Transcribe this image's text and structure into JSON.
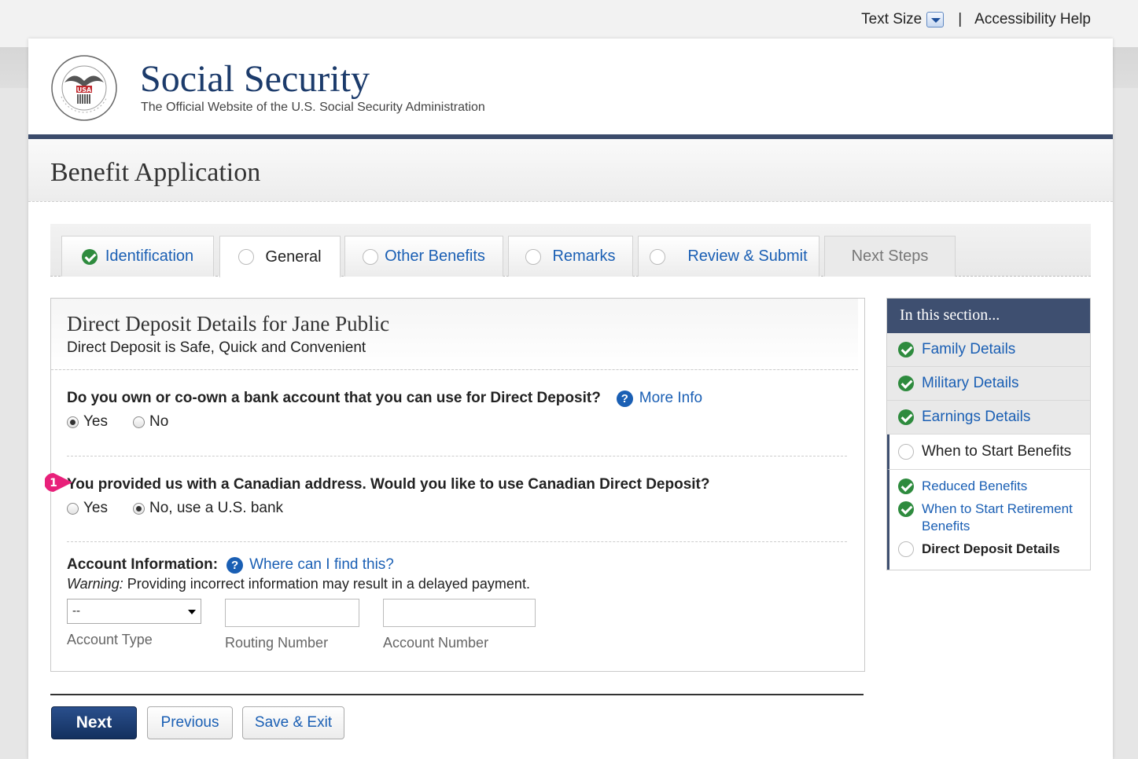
{
  "topbar": {
    "text_size": "Text Size",
    "separator": "|",
    "accessibility": "Accessibility Help"
  },
  "header": {
    "title": "Social Security",
    "subtitle": "The Official Website of the U.S. Social Security Administration",
    "seal_text": "SOCIAL SECURITY ADMINISTRATION USA"
  },
  "app": {
    "title": "Benefit Application"
  },
  "tabs": [
    {
      "label": "Identification",
      "status": "complete"
    },
    {
      "label": "General",
      "status": "current"
    },
    {
      "label": "Other Benefits",
      "status": "pending"
    },
    {
      "label": "Remarks",
      "status": "pending"
    },
    {
      "label": "Review & Submit",
      "status": "pending"
    },
    {
      "label": "Next Steps",
      "status": "disabled"
    }
  ],
  "form": {
    "title": "Direct Deposit Details for Jane Public",
    "subtitle": "Direct Deposit is Safe, Quick and Convenient",
    "q1": {
      "text": "Do you own or co-own a bank account that you can use for Direct Deposit?",
      "help": "More Info",
      "options": [
        "Yes",
        "No"
      ],
      "selected": "Yes"
    },
    "q2": {
      "badge": "1",
      "text": "You provided us with a Canadian address. Would you like to use Canadian Direct Deposit?",
      "options": [
        "Yes",
        "No, use a U.S. bank"
      ],
      "selected": "No, use a U.S. bank"
    },
    "account": {
      "label": "Account Information:",
      "help": "Where can I find this?",
      "warning_prefix": "Warning:",
      "warning_text": " Providing incorrect information may result in a delayed payment.",
      "type_value": "--",
      "type_label": "Account Type",
      "routing_label": "Routing Number",
      "account_label": "Account Number"
    }
  },
  "buttons": {
    "next": "Next",
    "previous": "Previous",
    "save_exit": "Save & Exit"
  },
  "sidebar": {
    "heading": "In this section...",
    "items": [
      {
        "label": "Family Details",
        "status": "complete"
      },
      {
        "label": "Military Details",
        "status": "complete"
      },
      {
        "label": "Earnings Details",
        "status": "complete"
      },
      {
        "label": "When to Start Benefits",
        "status": "current"
      }
    ],
    "subitems": [
      {
        "label": "Reduced Benefits",
        "status": "complete"
      },
      {
        "label": "When to Start Retirement Benefits",
        "status": "complete"
      },
      {
        "label": "Direct Deposit Details",
        "status": "current"
      }
    ]
  },
  "colors": {
    "brand_navy": "#3b4b6b",
    "link": "#1a5fb4",
    "check_green": "#2e8b3e",
    "badge_pink": "#e8207a"
  }
}
